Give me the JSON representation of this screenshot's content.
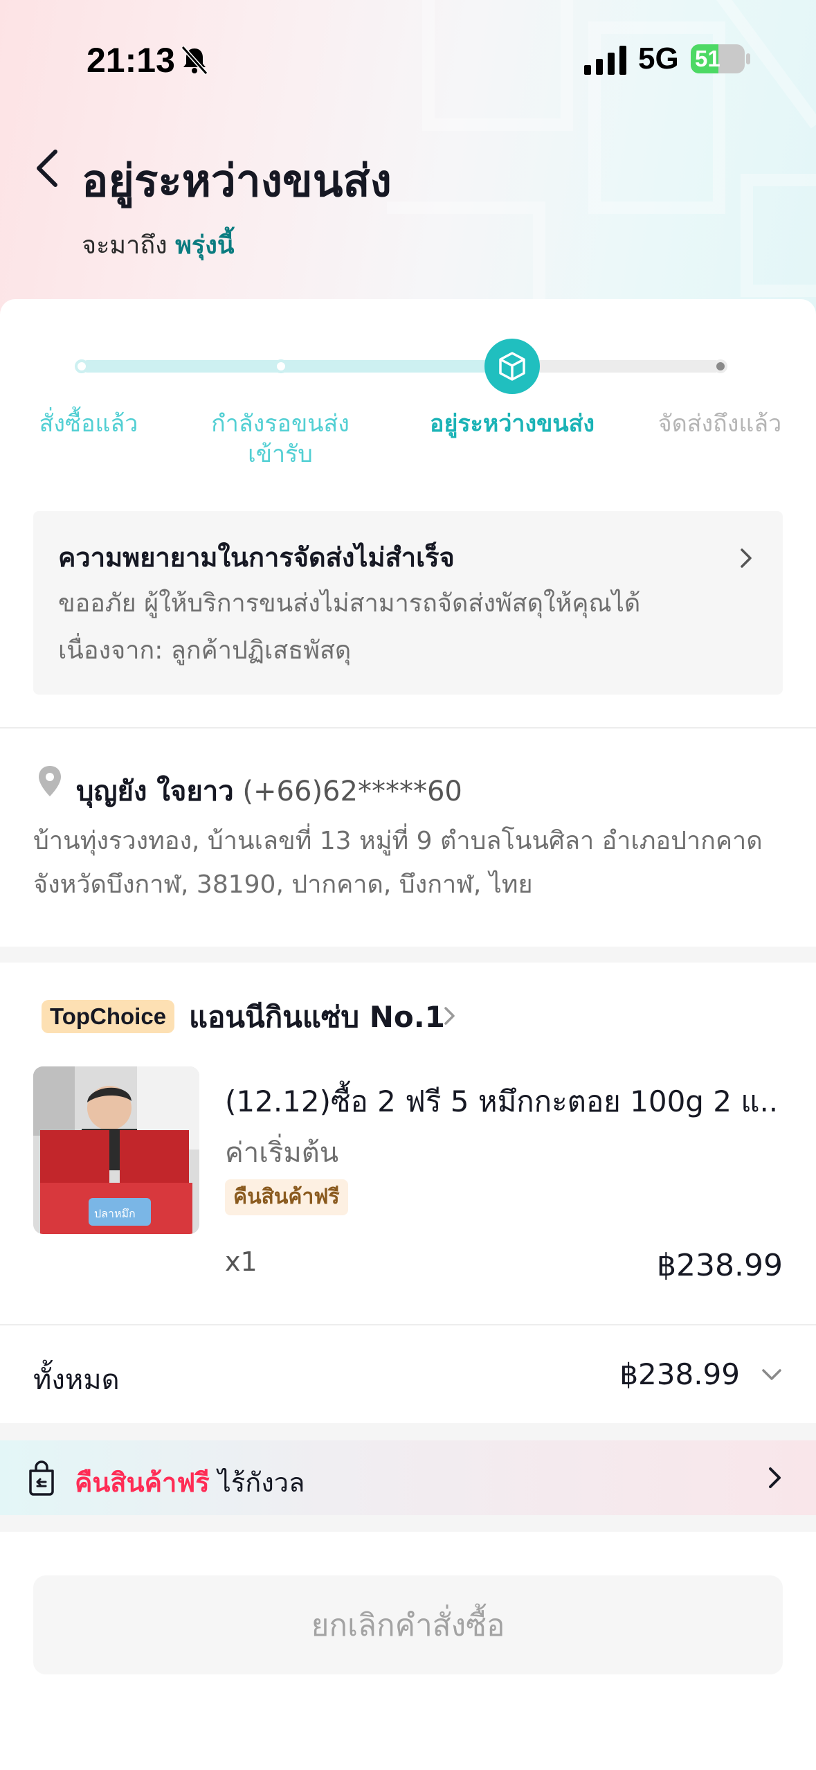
{
  "status_bar": {
    "time": "21:13",
    "network": "5G",
    "battery_percent": "51",
    "battery_level": 0.51
  },
  "header": {
    "title": "อยู่ระหว่างขนส่ง",
    "eta_prefix": "จะมาถึง",
    "eta_day": "พรุ่งนี้"
  },
  "progress": {
    "steps": [
      {
        "label": "สั่งซื้อแล้ว",
        "state": "done"
      },
      {
        "label": "กำลังรอขนส่ง",
        "label2": "เข้ารับ",
        "state": "done"
      },
      {
        "label": "อยู่ระหว่างขนส่ง",
        "state": "current"
      },
      {
        "label": "จัดส่งถึงแล้ว",
        "state": "pending"
      }
    ],
    "accent": "#1ab3b6"
  },
  "alert": {
    "title": "ความพยายามในการจัดส่งไม่สำเร็จ",
    "body": "ขออภัย ผู้ให้บริการขนส่งไม่สามารถจัดส่งพัสดุให้คุณได้ เนื่องจาก: ลูกค้าปฏิเสธพัสดุ"
  },
  "address": {
    "name": "บุญยัง ใจยาว",
    "phone": "(+66)62*****60",
    "line1": "บ้านทุ่งรวงทอง, บ้านเลขที่ 13 หมู่ที่ 9 ตำบลโนนศิลา อำเภอปากคาด",
    "line2": "จังหวัดบึงกาฬ, 38190, ปากคาด, บึงกาฬ, ไทย"
  },
  "shop": {
    "badge": "TopChoice",
    "name": "แอนนีกินแซ่บ No.1"
  },
  "product": {
    "title": "(12.12)ซื้อ 2 ฟรี 5 หมึกกะตอย 100g 2 แ...",
    "variant": "ค่าเริ่มต้น",
    "tag": "คืนสินค้าฟรี",
    "qty": "x1",
    "price": "฿238.99",
    "image_text": "ปลาหมึก"
  },
  "total": {
    "label": "ทั้งหมด",
    "value": "฿238.99"
  },
  "promo": {
    "highlight": "คืนสินค้าฟรี",
    "text": " ไร้กังวล"
  },
  "actions": {
    "cancel_label": "ยกเลิกคำสั่งซื้อ"
  }
}
